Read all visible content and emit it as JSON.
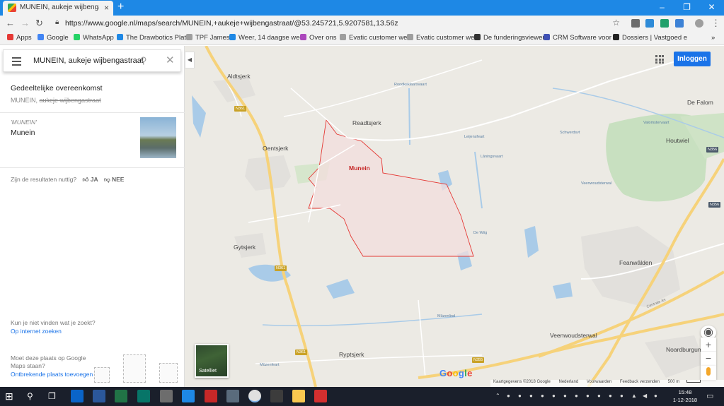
{
  "browser": {
    "tab_title": "MUNEIN, aukeje wijbengastraat",
    "url": "https://www.google.nl/maps/search/MUNEIN,+aukeje+wijbengastraat/@53.245721,5.9207581,13.56z",
    "bookmarks": [
      "Apps",
      "Google",
      "WhatsApp",
      "The Drawbotics Platf",
      "TPF James",
      "Weer, 14 daagse wee",
      "Over ons",
      "Evatic customer web",
      "Evatic customer web",
      "De funderingsviewer",
      "CRM Software voor e",
      "Dossiers | Vastgoed e"
    ],
    "bookmark_colors": [
      "#e53935",
      "#4285f4",
      "#25d366",
      "#1e88e5",
      "#9e9e9e",
      "#1e88e5",
      "#ab47bc",
      "#9e9e9e",
      "#9e9e9e",
      "#333333",
      "#3f51b5",
      "#222222"
    ]
  },
  "search": {
    "query": "MUNEIN, aukeje wijbengastraat"
  },
  "results": {
    "partial_heading": "Gedeeltelijke overeenkomst",
    "partial_prefix": "MUNEIN,",
    "partial_strike": "aukeje wijbengastraat",
    "result_query": "'MUNEIN'",
    "result_name": "Munein",
    "helpful_question": "Zijn de resultaten nuttig?",
    "yes": "JA",
    "no": "NEE",
    "not_found": "Kun je niet vinden wat je zoekt?",
    "search_internet": "Op internet zoeken",
    "missing_place": "Moet deze plaats op Google Maps staan?",
    "add_missing": "Ontbrekende plaats toevoegen"
  },
  "map": {
    "login": "Inloggen",
    "satellite": "Satelliet",
    "selected_place": "Munein",
    "towns": [
      "Aldtsjerk",
      "Readtsjerk",
      "Oentsjerk",
      "Gytsjerk",
      "Ryptsjerk",
      "Feanwâlden",
      "Houtwiel",
      "De Falom",
      "Veenwoudsterwal",
      "Noardburgum"
    ],
    "small_labels": [
      "Roodkeklaarsvaart",
      "Valomstervaart",
      "Schwerdsvt",
      "Leijensfeart",
      "Lâningsvaart",
      "Veenwoudsterwal",
      "De Wiig",
      "Mûzenlind",
      "Mûzenfeart"
    ],
    "roads": [
      "N361",
      "N361",
      "N361",
      "N356",
      "N356",
      "N355",
      "Centrale As"
    ],
    "attribution": [
      "Kaartgegevens ©2018 Google",
      "Nederland",
      "Voorwaarden",
      "Feedback verzenden",
      "500 m"
    ],
    "google_logo": [
      "G",
      "o",
      "o",
      "g",
      "l",
      "e"
    ],
    "google_colors": [
      "#4285f4",
      "#ea4335",
      "#fbbc05",
      "#4285f4",
      "#34a853",
      "#ea4335"
    ],
    "boundary_color": "#e53935",
    "boundary_fill": "#f3dede"
  },
  "taskbar": {
    "time": "15:48",
    "date": "1-12-2018"
  }
}
